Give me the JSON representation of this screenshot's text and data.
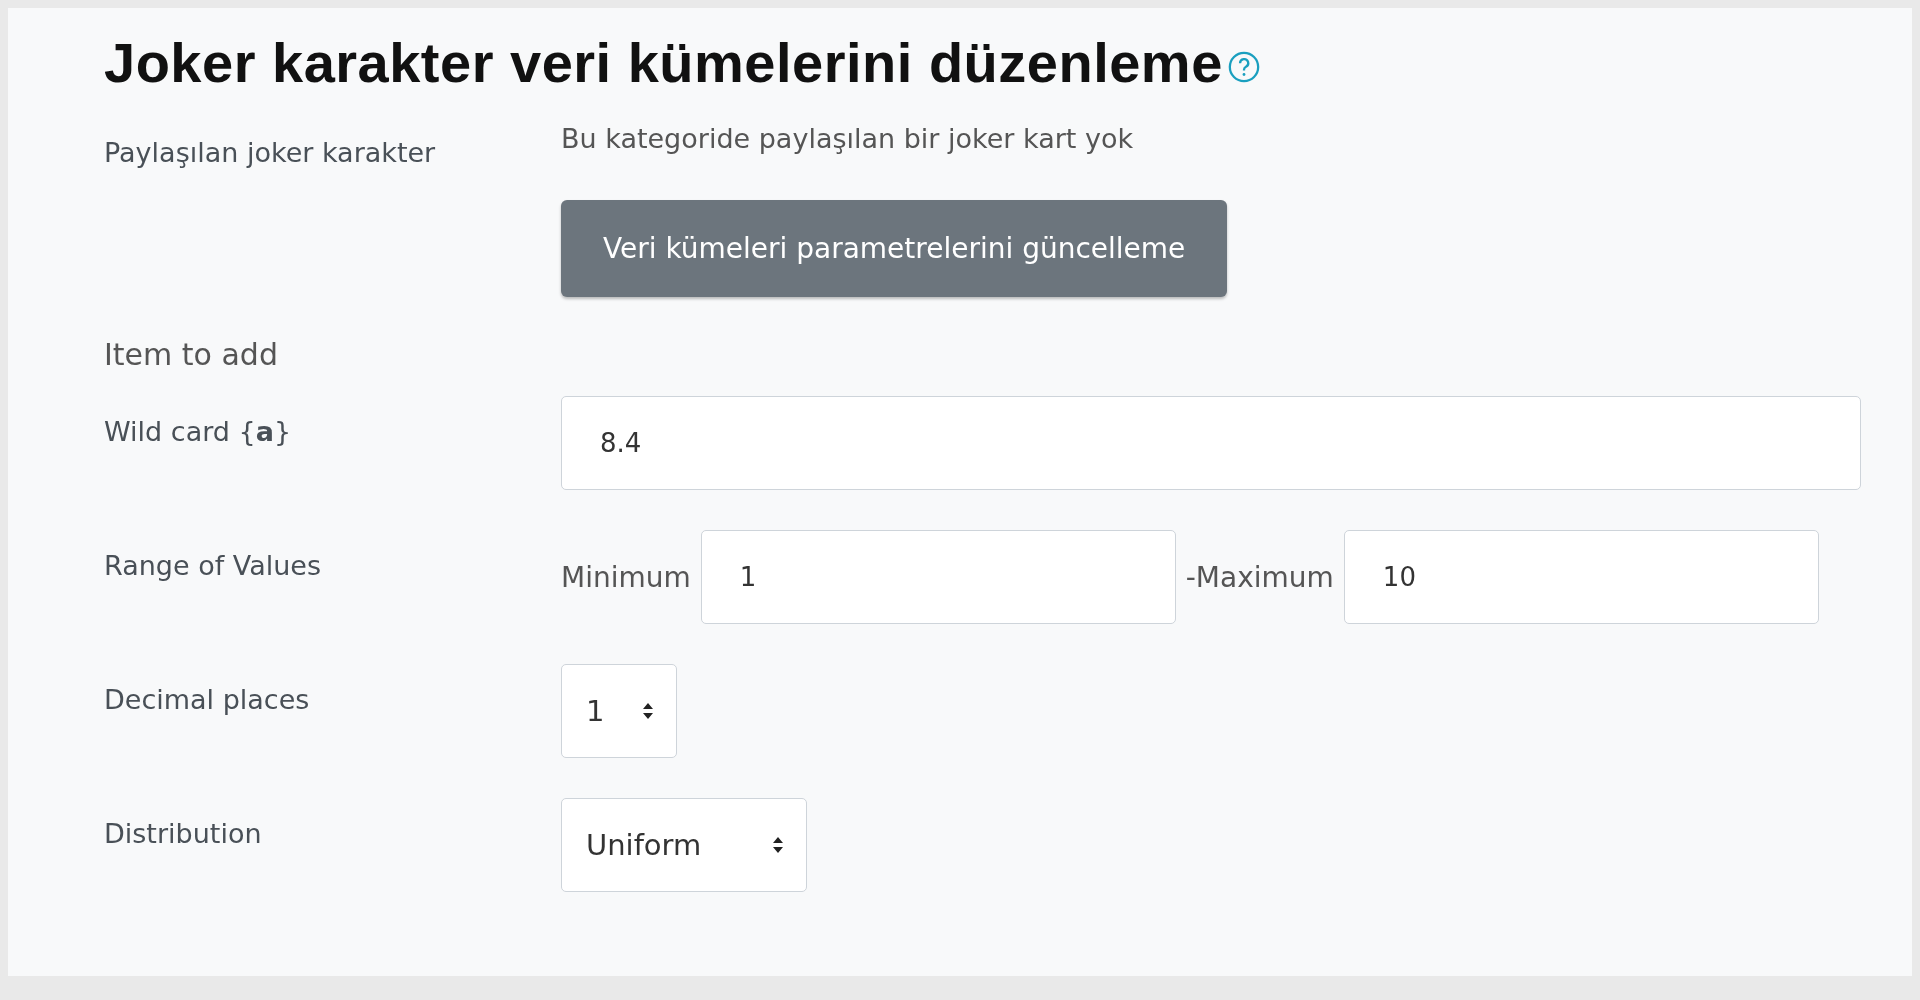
{
  "title": "Joker karakter veri kümelerini düzenleme",
  "shared": {
    "label": "Paylaşılan joker karakter",
    "message": "Bu kategoride paylaşılan bir joker kart yok",
    "button": "Veri kümeleri parametrelerini güncelleme"
  },
  "section": "Item to add",
  "wildcard": {
    "label": "Wild card {**a**}",
    "value": "8.4"
  },
  "range": {
    "label": "Range of Values",
    "min_label": "Minimum",
    "min_value": "1",
    "max_label": "-Maximum",
    "max_value": "10"
  },
  "decimal": {
    "label": "Decimal places",
    "value": "1"
  },
  "distribution": {
    "label": "Distribution",
    "value": "Uniform"
  }
}
